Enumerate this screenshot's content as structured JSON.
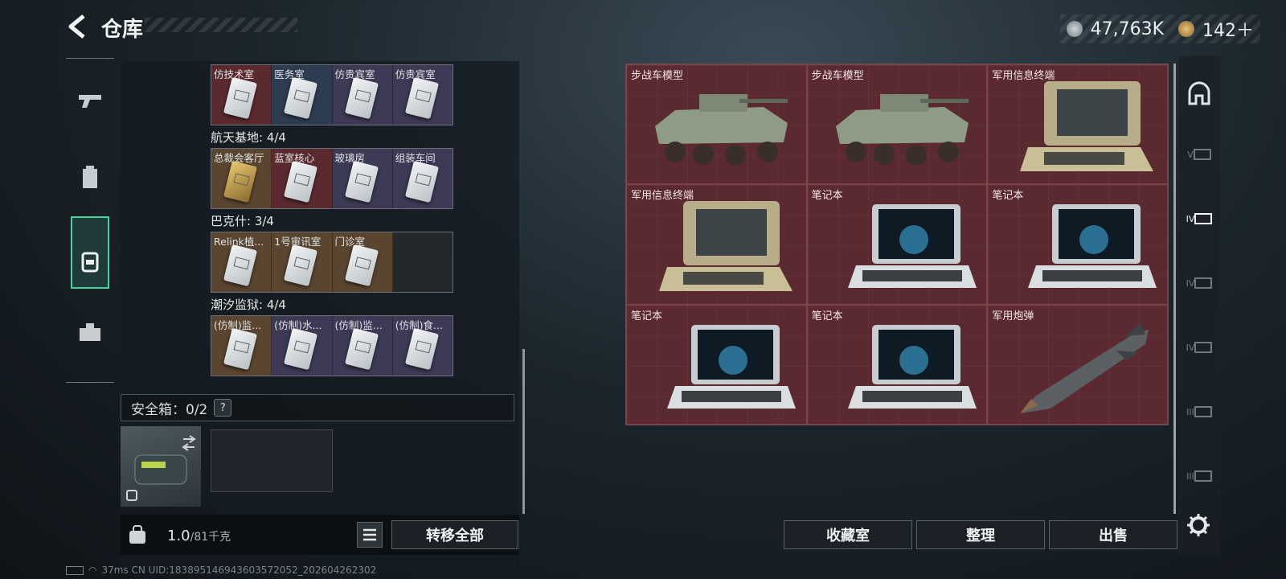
{
  "header": {
    "title": "仓库",
    "money": "47,763K",
    "tokens": "142＋"
  },
  "left_nav": [
    "weapon-icon",
    "armor-icon",
    "backpack-icon",
    "toolbox-icon"
  ],
  "keycard_groups": [
    {
      "title": "",
      "cards": [
        {
          "label": "仿技术室",
          "color": "red"
        },
        {
          "label": "医务室",
          "color": "blue"
        },
        {
          "label": "仿贵宾室",
          "color": "purple"
        },
        {
          "label": "仿贵宾室",
          "color": "purple"
        }
      ]
    },
    {
      "title": "航天基地: 4/4",
      "cards": [
        {
          "label": "总裁会客厅",
          "color": "gold"
        },
        {
          "label": "蓝室核心",
          "color": "red"
        },
        {
          "label": "玻璃房",
          "color": "purple"
        },
        {
          "label": "组装车间",
          "color": "purple"
        }
      ]
    },
    {
      "title": "巴克什: 3/4",
      "cards": [
        {
          "label": "Relink植...",
          "color": "gold"
        },
        {
          "label": "1号审讯室",
          "color": "gold"
        },
        {
          "label": "门诊室",
          "color": "gold"
        },
        {
          "label": "",
          "color": "dark"
        }
      ]
    },
    {
      "title": "潮汐监狱: 4/4",
      "cards": [
        {
          "label": "(仿制)监...",
          "color": "gold"
        },
        {
          "label": "(仿制)水...",
          "color": "purple"
        },
        {
          "label": "(仿制)监...",
          "color": "purple"
        },
        {
          "label": "(仿制)食...",
          "color": "purple"
        }
      ]
    }
  ],
  "safe_box": {
    "title": "安全箱：0/2",
    "help": "?"
  },
  "footer": {
    "weight": "1.0",
    "weight_cap": "/81千克",
    "transfer_all": "转移全部"
  },
  "grid_items": [
    {
      "label": "步战车模型",
      "icon": "apc-model-icon"
    },
    {
      "label": "步战车模型",
      "icon": "apc-model-icon"
    },
    {
      "label": "军用信息终端",
      "icon": "military-terminal-icon"
    },
    {
      "label": "军用信息终端",
      "icon": "military-terminal-icon"
    },
    {
      "label": "笔记本",
      "icon": "laptop-icon"
    },
    {
      "label": "笔记本",
      "icon": "laptop-icon"
    },
    {
      "label": "笔记本",
      "icon": "laptop-icon"
    },
    {
      "label": "笔记本",
      "icon": "laptop-icon"
    },
    {
      "label": "军用炮弹",
      "icon": "artillery-shell-icon"
    }
  ],
  "right_nav": [
    "helmet-icon",
    "V",
    "IV",
    "IV",
    "IV",
    "III",
    "III"
  ],
  "actions": {
    "collection": "收藏室",
    "sort": "整理",
    "sell": "出售"
  },
  "status": "37ms     CN UID:18389514694360357​2052_202604262302",
  "colors": {
    "accent": "#41d7a2",
    "item_bg": "#5b2a30"
  }
}
